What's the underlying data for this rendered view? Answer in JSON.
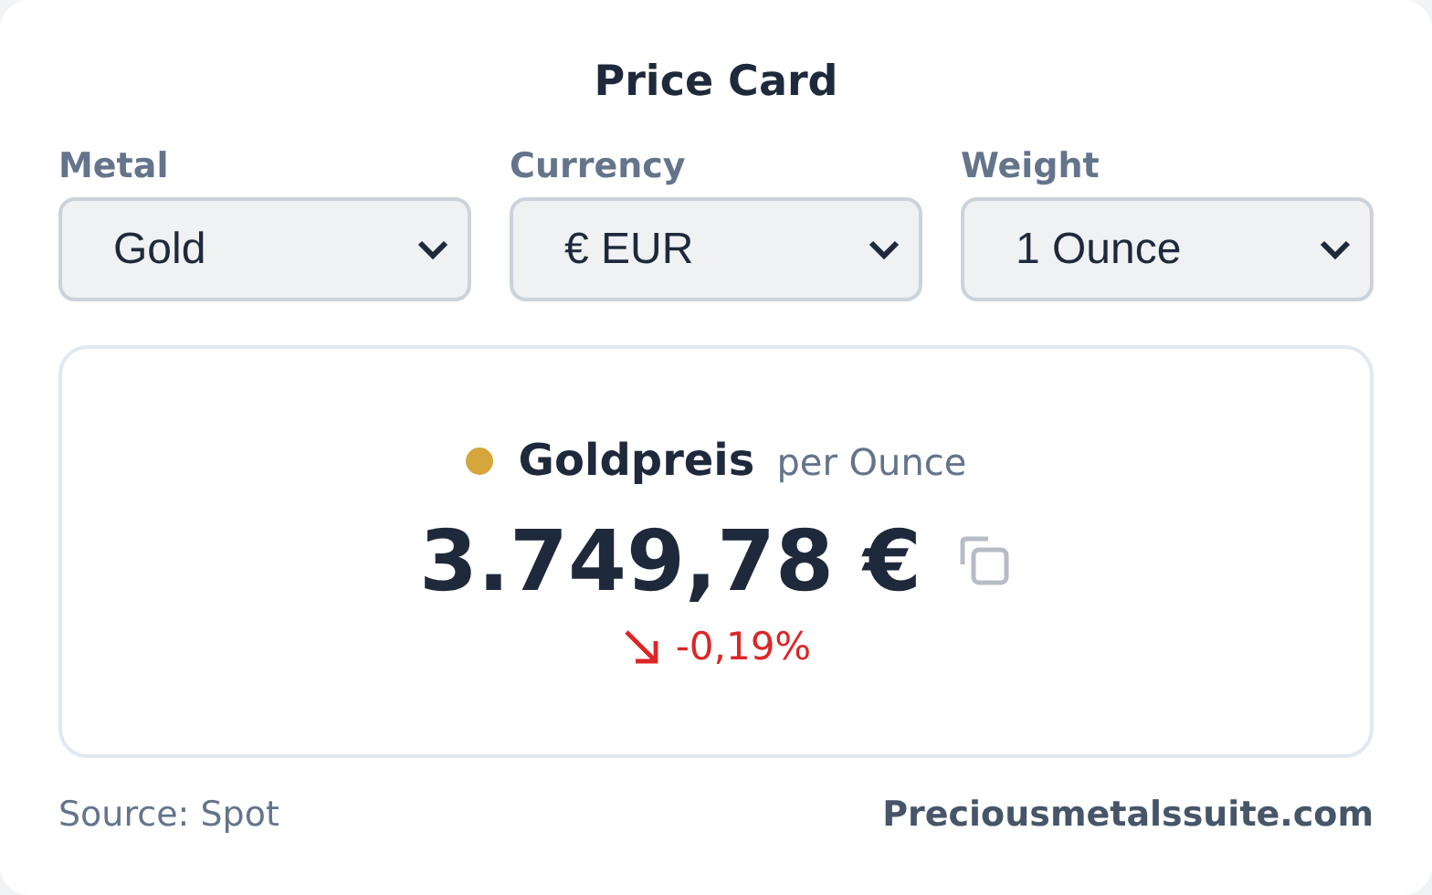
{
  "title": "Price Card",
  "selects": [
    {
      "label": "Metal",
      "value": "Gold"
    },
    {
      "label": "Currency",
      "value": "€ EUR"
    },
    {
      "label": "Weight",
      "value": "1 Ounce"
    }
  ],
  "price": {
    "name": "Goldpreis",
    "unit": "per Ounce",
    "amount": "3.749,78 €",
    "change": {
      "kind": "down",
      "text": "-0,19%"
    }
  },
  "footer": {
    "source": "Source: Spot",
    "site": "Preciousmetalssuite.com"
  }
}
